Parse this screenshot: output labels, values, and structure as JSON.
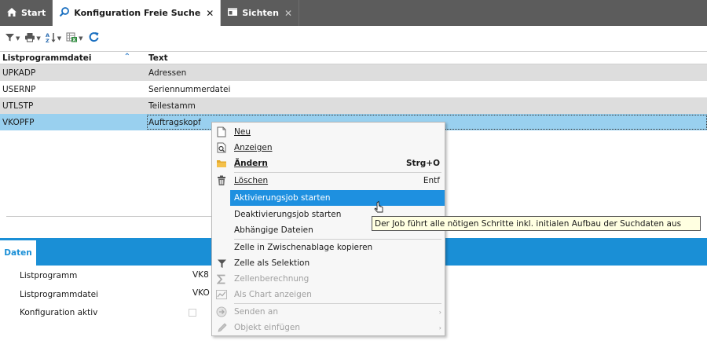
{
  "tabs": [
    {
      "label": "Start",
      "icon": "home-icon"
    },
    {
      "label": "Konfiguration Freie Suche",
      "icon": "search-icon",
      "close": "✕"
    },
    {
      "label": "Sichten",
      "icon": "window-icon",
      "close": "✕"
    }
  ],
  "toolbar": {
    "filter": "filter-icon",
    "print": "print-icon",
    "sort": "sort-az-icon",
    "export": "excel-export-icon",
    "refresh": "refresh-icon"
  },
  "table": {
    "headers": [
      "Listprogrammdatei",
      "Text"
    ],
    "sort_indicator": "⌃",
    "rows": [
      {
        "col1": "UPKADP",
        "col2": "Adressen"
      },
      {
        "col1": "USERNP",
        "col2": "Seriennummerdatei"
      },
      {
        "col1": "UTLSTP",
        "col2": "Teilestamm"
      },
      {
        "col1": "VKOPFP",
        "col2": "Auftragskopf"
      }
    ]
  },
  "panel": {
    "tab_label": "Daten",
    "fields": [
      {
        "label": "Listprogramm",
        "value": "VK8"
      },
      {
        "label": "Listprogrammdatei",
        "value": "VKO"
      },
      {
        "label": "Konfiguration aktiv",
        "value": ""
      }
    ]
  },
  "context_menu": {
    "items": [
      {
        "label": "Neu",
        "icon": "new-document-icon"
      },
      {
        "label": "Anzeigen",
        "icon": "view-document-icon"
      },
      {
        "label": "Ändern",
        "icon": "folder-edit-icon",
        "shortcut": "Strg+O"
      },
      {
        "label": "Löschen",
        "icon": "trash-icon",
        "shortcut": "Entf"
      },
      {
        "label": "Aktivierungsjob starten"
      },
      {
        "label": "Deaktivierungsjob starten"
      },
      {
        "label": "Abhängige Dateien"
      },
      {
        "label": "Zelle in Zwischenablage kopieren"
      },
      {
        "label": "Zelle als Selektion",
        "icon": "filter-icon"
      },
      {
        "label": "Zellenberechnung",
        "icon": "sum-icon"
      },
      {
        "label": "Als Chart anzeigen",
        "icon": "chart-icon"
      },
      {
        "label": "Senden an",
        "icon": "send-icon",
        "submenu": "›"
      },
      {
        "label": "Objekt einfügen",
        "icon": "pencil-icon",
        "submenu": "›"
      }
    ]
  },
  "tooltip": {
    "text": "Der Job führt alle nötigen Schritte inkl. initialen Aufbau der Suchdaten aus"
  },
  "colors": {
    "accent": "#1a8fd6",
    "tabbar": "#5c5c5c",
    "selected_row": "#99d0ef",
    "menu_highlight": "#1e90e0"
  }
}
